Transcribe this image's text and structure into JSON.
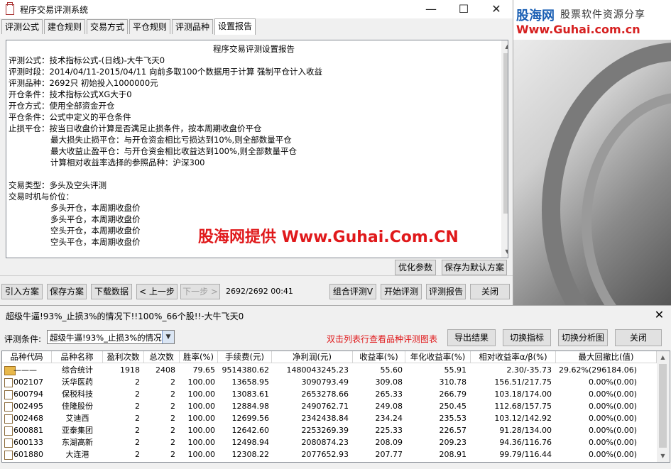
{
  "window": {
    "title": "程序交易评测系统",
    "minimize": "—",
    "maximize": "☐",
    "close": "✕"
  },
  "tabs": [
    "评测公式",
    "建仓规则",
    "交易方式",
    "平仓规则",
    "评测品种",
    "设置报告"
  ],
  "report": {
    "heading": "程序交易评测设置报告",
    "lines": [
      "评测公式：技术指标公式-(日线)-大牛飞天0",
      "评测时段：2014/04/11-2015/04/11 向前多取100个数据用于计算 强制平仓计入收益",
      "评测品种：2692只 初始投入1000000元",
      "开仓条件：技术指标公式XG大于0",
      "开仓方式：使用全部资金开仓",
      "平仓条件：公式中定义的平仓条件",
      "止损平仓：按当日收盘价计算是否满足止损条件，按本周期收盘价平仓",
      "最大损失止损平仓：与开仓资金相比亏损达到10%,则全部数量平仓",
      "最大收益止盈平仓：与开仓资金相比收益达到100%,则全部数量平仓",
      "计算相对收益率选择的参照品种：沪深300",
      "交易类型：多头及空头评测",
      "交易时机与价位：",
      "多头开仓，本周期收盘价",
      "多头平仓，本周期收盘价",
      "空头开仓，本周期收盘价",
      "空头平仓，本周期收盘价"
    ]
  },
  "report_buttons": {
    "optimize": "优化参数",
    "save_default": "保存为默认方案"
  },
  "toolbar": {
    "import": "引入方案",
    "save": "保存方案",
    "download": "下载数据",
    "prev": "< 上一步",
    "next": "下一步 >",
    "progress": "2692/2692 00:41",
    "combo": "组合评测V",
    "start": "开始评测",
    "report": "评测报告",
    "close": "关闭"
  },
  "banner": {
    "logo_cn": "股海网",
    "logo_slogan": "股票软件资源分享",
    "logo_url": "Www.Guhai.com.cn"
  },
  "watermark": "股海网提供 Www.Guhai.Com.CN",
  "results": {
    "title": "超级牛逼!93%_止损3%的情况下!!100%_66个股!!-大牛飞天0",
    "close": "✕",
    "condition_label": "评测条件:",
    "condition_value": "超级牛逼!93%_止损3%的情况下",
    "hint": "双击列表行查看品种评测图表",
    "export": "导出结果",
    "switch_indicator": "切换指标",
    "switch_chart": "切换分析图",
    "close_btn": "关闭",
    "columns": [
      "品种代码",
      "品种名称",
      "盈利次数",
      "总次数",
      "胜率(%)",
      "手续费(元)",
      "净利润(元)",
      "收益率(%)",
      "年化收益率(%)",
      "相对收益率α/β(%)",
      "最大回撤比(值)"
    ],
    "rows": [
      [
        "———",
        "综合统计",
        "1918",
        "2408",
        "79.65",
        "9514380.62",
        "1480043245.23",
        "55.60",
        "55.91",
        "2.30/-35.73",
        "29.62%(296184.06)"
      ],
      [
        "002107",
        "沃华医药",
        "2",
        "2",
        "100.00",
        "13658.95",
        "3090793.49",
        "309.08",
        "310.78",
        "156.51/217.75",
        "0.00%(0.00)"
      ],
      [
        "600794",
        "保税科技",
        "2",
        "2",
        "100.00",
        "13083.61",
        "2653278.66",
        "265.33",
        "266.79",
        "103.18/174.00",
        "0.00%(0.00)"
      ],
      [
        "002495",
        "佳隆股份",
        "2",
        "2",
        "100.00",
        "12884.98",
        "2490762.71",
        "249.08",
        "250.45",
        "112.68/157.75",
        "0.00%(0.00)"
      ],
      [
        "002468",
        "艾迪西",
        "2",
        "2",
        "100.00",
        "12699.56",
        "2342438.84",
        "234.24",
        "235.53",
        "103.12/142.92",
        "0.00%(0.00)"
      ],
      [
        "600881",
        "亚泰集团",
        "2",
        "2",
        "100.00",
        "12642.60",
        "2253269.39",
        "225.33",
        "226.57",
        "91.28/134.00",
        "0.00%(0.00)"
      ],
      [
        "600133",
        "东湖高新",
        "2",
        "2",
        "100.00",
        "12498.94",
        "2080874.23",
        "208.09",
        "209.23",
        "94.36/116.76",
        "0.00%(0.00)"
      ],
      [
        "601880",
        "大连港",
        "2",
        "2",
        "100.00",
        "12308.22",
        "2077652.93",
        "207.77",
        "208.91",
        "99.79/116.44",
        "0.00%(0.00)"
      ]
    ]
  }
}
